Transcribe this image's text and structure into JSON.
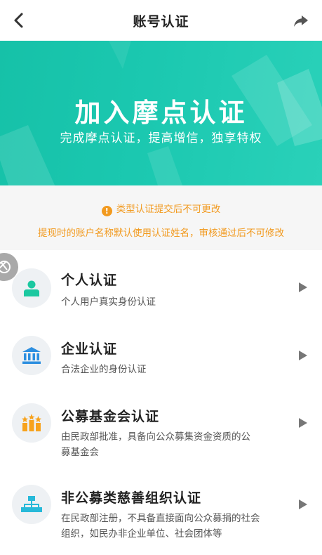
{
  "header": {
    "title": "账号认证"
  },
  "banner": {
    "title": "加入摩点认证",
    "subtitle": "完成摩点认证，提高增信，独享特权"
  },
  "notice": {
    "line1": "类型认证提交后不可更改",
    "line2": "提现时的账户名称默认使用认证姓名，审核通过后不可修改"
  },
  "items": [
    {
      "title": "个人认证",
      "desc": "个人用户真实身份认证",
      "icon": "person-icon"
    },
    {
      "title": "企业认证",
      "desc": "合法企业的身份认证",
      "icon": "bank-icon"
    },
    {
      "title": "公募基金会认证",
      "desc": "由民政部批准，具备向公众募集资金资质的公募基金会",
      "icon": "foundation-icon"
    },
    {
      "title": "非公募类慈善组织认证",
      "desc": "在民政部注册，不具备直接面向公众募捐的社会组织，如民办非企业单位、社会团体等",
      "icon": "org-chart-icon"
    }
  ],
  "colors": {
    "banner": "#1bc8b0",
    "accent_green": "#1bc8a0",
    "accent_blue": "#2d8fe0",
    "accent_orange": "#f7a21c",
    "accent_cyan": "#27b9d9",
    "warning": "#f29a1f"
  }
}
